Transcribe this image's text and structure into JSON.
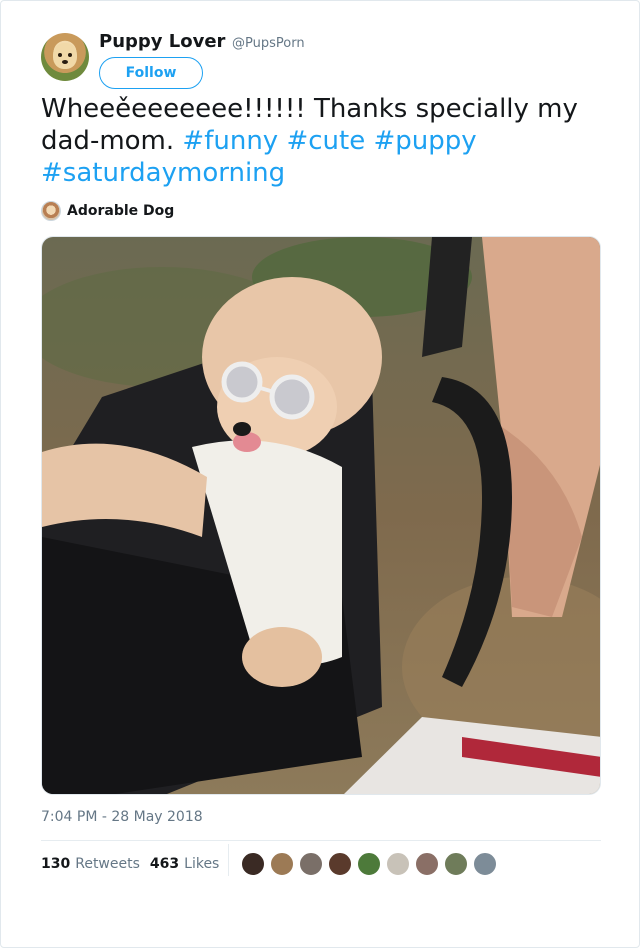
{
  "author": {
    "name": "Puppy Lover",
    "handle": "@PupsPorn",
    "follow_label": "Follow",
    "avatar_icon": "puppy-avatar"
  },
  "tweet": {
    "text": "Wheeěeeeeeee!!!!!! Thanks specially my dad-mom.",
    "hashtags": [
      "#funny",
      "#cute",
      "#puppy",
      "#saturdaymorning"
    ],
    "source_label": "Adorable Dog",
    "timestamp": "7:04 PM - 28 May 2018"
  },
  "stats": {
    "retweets_count": "130",
    "retweets_label": "Retweets",
    "likes_count": "463",
    "likes_label": "Likes"
  },
  "media": {
    "description_icon": "video-thumbnail"
  },
  "likers": [
    "#3a2a24",
    "#9c7a55",
    "#7a6f68",
    "#5a3a2c",
    "#4d7a3a",
    "#c8c2b8",
    "#8a6f66",
    "#6f7c5a",
    "#7d8c98"
  ],
  "colors": {
    "accent": "#1da1f2",
    "text": "#14171a",
    "muted": "#657786"
  }
}
